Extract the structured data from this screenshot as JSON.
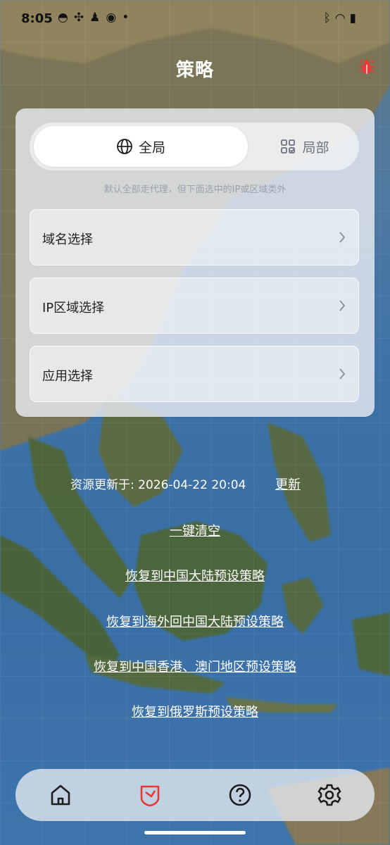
{
  "status_bar": {
    "time": "8:05",
    "left_icons": [
      "bowl-icon",
      "fan-icon",
      "keyhole-icon",
      "weibo-icon",
      "dot-icon"
    ],
    "right_icons": [
      "bluetooth-icon",
      "wifi-icon",
      "battery-icon"
    ]
  },
  "header": {
    "title": "策略",
    "debug_icon": "bug-icon",
    "accent": "#e53935"
  },
  "mode_toggle": {
    "global_label": "全局",
    "local_label": "局部",
    "selected": "global",
    "hint": "默认全部走代理，但下面选中的IP或区域类外"
  },
  "options": [
    {
      "label": "域名选择"
    },
    {
      "label": "IP区域选择"
    },
    {
      "label": "应用选择"
    }
  ],
  "resources": {
    "updated_text": "资源更新于: 2026-04-22 20:04",
    "update_link": "更新"
  },
  "actions": [
    {
      "label": "一键清空"
    },
    {
      "label": "恢复到中国大陆预设策略"
    },
    {
      "label": "恢复到海外回中国大陆预设策略"
    },
    {
      "label": "恢复到中国香港、澳门地区预设策略"
    },
    {
      "label": "恢复到俄罗斯预设策略"
    }
  ],
  "bottom_nav": {
    "items": [
      "home-icon",
      "shield-icon",
      "help-icon",
      "settings-icon"
    ],
    "active": "shield-icon",
    "active_color": "#e53935"
  }
}
